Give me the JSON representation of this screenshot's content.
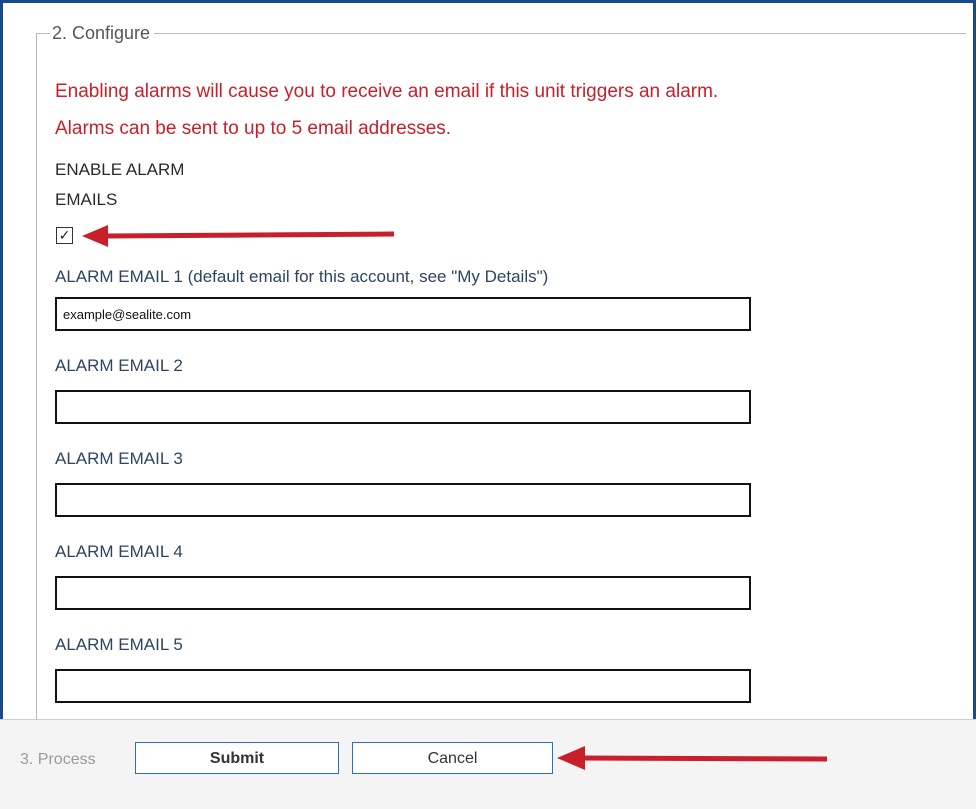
{
  "fieldset": {
    "legend": "2. Configure"
  },
  "messages": {
    "line1": "Enabling alarms will cause you to receive an email if this unit triggers an alarm.",
    "line2": "Alarms can be sent to up to 5 email addresses."
  },
  "enable": {
    "label_line1": "ENABLE ALARM",
    "label_line2": "EMAILS",
    "checked": true,
    "check_glyph": "✓"
  },
  "emails": [
    {
      "label": "ALARM EMAIL 1 (default email for this account, see \"My Details\")",
      "value": "example@sealite.com"
    },
    {
      "label": "ALARM EMAIL 2",
      "value": ""
    },
    {
      "label": "ALARM EMAIL 3",
      "value": ""
    },
    {
      "label": "ALARM EMAIL 4",
      "value": ""
    },
    {
      "label": "ALARM EMAIL 5",
      "value": ""
    }
  ],
  "process": {
    "label": "3. Process",
    "submit_label": "Submit",
    "cancel_label": "Cancel"
  },
  "colors": {
    "frame": "#1a4a8c",
    "message": "#c8202a",
    "field_label": "#2e4460",
    "button_border": "#2a6fc0",
    "arrow": "#c8202a"
  },
  "icons": {
    "annotation_arrow": "arrow-left-icon",
    "checkbox_mark": "check-icon"
  }
}
